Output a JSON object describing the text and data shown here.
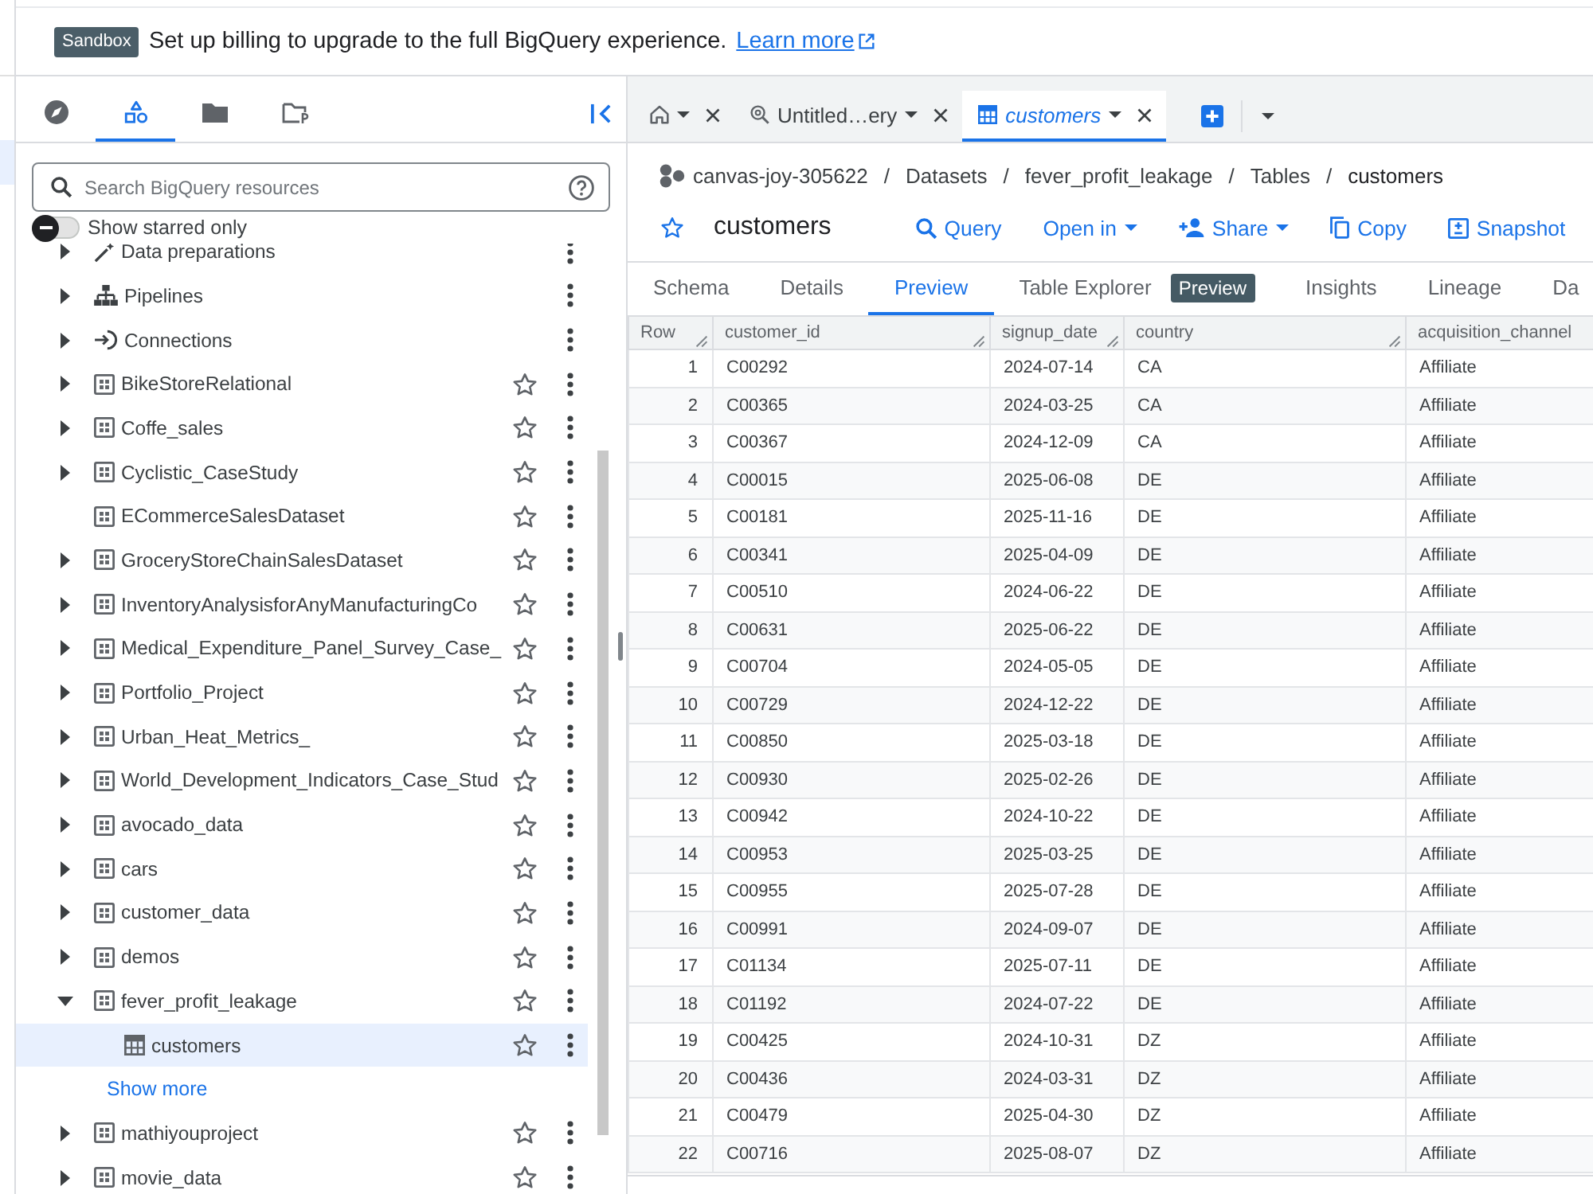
{
  "banner": {
    "badge": "Sandbox",
    "message": "Set up billing to upgrade to the full BigQuery experience.",
    "link": "Learn more"
  },
  "explorer": {
    "icon_tabs": [
      {
        "kind": "explore",
        "selected": false
      },
      {
        "kind": "resources",
        "selected": true
      },
      {
        "kind": "files",
        "selected": false
      },
      {
        "kind": "repositories",
        "selected": false
      }
    ],
    "search": {
      "placeholder": "Search BigQuery resources"
    },
    "starred_filter": {
      "label": "Show starred only",
      "on": false
    },
    "tree": [
      {
        "kind": "data_preparations",
        "label": "Data preparations",
        "expandable": true,
        "expanded": false,
        "selected": false
      },
      {
        "kind": "pipelines",
        "label": "Pipelines",
        "expandable": true,
        "expanded": false,
        "selected": false
      },
      {
        "kind": "connections",
        "label": "Connections",
        "expandable": true,
        "expanded": false,
        "selected": false
      },
      {
        "kind": "dataset",
        "label": "BikeStoreRelational",
        "expandable": true,
        "expanded": false,
        "selected": false,
        "starred": false
      },
      {
        "kind": "dataset",
        "label": "Coffe_sales",
        "expandable": true,
        "expanded": false,
        "selected": false,
        "starred": false
      },
      {
        "kind": "dataset",
        "label": "Cyclistic_CaseStudy",
        "expandable": true,
        "expanded": false,
        "selected": false,
        "starred": false
      },
      {
        "kind": "dataset",
        "label": "ECommerceSalesDataset",
        "expandable": false,
        "selected": false,
        "starred": false
      },
      {
        "kind": "dataset",
        "label": "GroceryStoreChainSalesDataset",
        "expandable": true,
        "expanded": false,
        "selected": false,
        "starred": false
      },
      {
        "kind": "dataset",
        "label": "InventoryAnalysisforAnyManufacturingCo",
        "expandable": true,
        "expanded": false,
        "selected": false,
        "starred": false
      },
      {
        "kind": "dataset",
        "label": "Medical_Expenditure_Panel_Survey_Case_",
        "expandable": true,
        "expanded": false,
        "selected": false,
        "starred": false
      },
      {
        "kind": "dataset",
        "label": "Portfolio_Project",
        "expandable": true,
        "expanded": false,
        "selected": false,
        "starred": false
      },
      {
        "kind": "dataset",
        "label": "Urban_Heat_Metrics_",
        "expandable": true,
        "expanded": false,
        "selected": false,
        "starred": false
      },
      {
        "kind": "dataset",
        "label": "World_Development_Indicators_Case_Stud",
        "expandable": true,
        "expanded": false,
        "selected": false,
        "starred": false
      },
      {
        "kind": "dataset",
        "label": "avocado_data",
        "expandable": true,
        "expanded": false,
        "selected": false,
        "starred": false
      },
      {
        "kind": "dataset",
        "label": "cars",
        "expandable": true,
        "expanded": false,
        "selected": false,
        "starred": false
      },
      {
        "kind": "dataset",
        "label": "customer_data",
        "expandable": true,
        "expanded": false,
        "selected": false,
        "starred": false
      },
      {
        "kind": "dataset",
        "label": "demos",
        "expandable": true,
        "expanded": false,
        "selected": false,
        "starred": false
      },
      {
        "kind": "dataset",
        "label": "fever_profit_leakage",
        "expandable": true,
        "expanded": true,
        "selected": false,
        "starred": false,
        "children": [
          {
            "kind": "table",
            "label": "customers",
            "expandable": false,
            "selected": true,
            "starred": false
          }
        ],
        "show_more": "Show more"
      },
      {
        "kind": "dataset",
        "label": "mathiyouproject",
        "expandable": true,
        "expanded": false,
        "selected": false,
        "starred": false
      },
      {
        "kind": "dataset",
        "label": "movie_data",
        "expandable": true,
        "expanded": false,
        "selected": false,
        "starred": false
      }
    ]
  },
  "editor_tabs": [
    {
      "kind": "home",
      "selected": false
    },
    {
      "kind": "query",
      "label": "Untitled…ery",
      "selected": false,
      "temporary": false
    },
    {
      "kind": "table",
      "label": "customers",
      "selected": true,
      "temporary": true
    }
  ],
  "breadcrumb": {
    "separator": "/",
    "items": [
      {
        "label": "canvas-joy-305622",
        "current": false
      },
      {
        "label": "Datasets",
        "current": false
      },
      {
        "label": "fever_profit_leakage",
        "current": false
      },
      {
        "label": "Tables",
        "current": false
      },
      {
        "label": "customers",
        "current": true
      }
    ]
  },
  "header": {
    "starred": false,
    "title": "customers",
    "actions": [
      {
        "kind": "query",
        "label": "Query",
        "menu": false
      },
      {
        "kind": "open",
        "label": "Open in",
        "menu": true
      },
      {
        "kind": "share",
        "label": "Share",
        "menu": true
      },
      {
        "kind": "copy",
        "label": "Copy",
        "menu": false
      },
      {
        "kind": "snapshot",
        "label": "Snapshot",
        "menu": false
      }
    ]
  },
  "detail_tabs": [
    {
      "label": "Schema",
      "selected": false
    },
    {
      "label": "Details",
      "selected": false
    },
    {
      "label": "Preview",
      "selected": true
    },
    {
      "label": "Table Explorer",
      "badge": "Preview",
      "selected": false
    },
    {
      "label": "Insights",
      "selected": false
    },
    {
      "label": "Lineage",
      "selected": false
    },
    {
      "label": "Da",
      "selected": false
    }
  ],
  "table": {
    "columns": [
      "Row",
      "customer_id",
      "signup_date",
      "country",
      "acquisition_channel"
    ],
    "rows": [
      [
        "1",
        "C00292",
        "2024-07-14",
        "CA",
        "Affiliate"
      ],
      [
        "2",
        "C00365",
        "2024-03-25",
        "CA",
        "Affiliate"
      ],
      [
        "3",
        "C00367",
        "2024-12-09",
        "CA",
        "Affiliate"
      ],
      [
        "4",
        "C00015",
        "2025-06-08",
        "DE",
        "Affiliate"
      ],
      [
        "5",
        "C00181",
        "2025-11-16",
        "DE",
        "Affiliate"
      ],
      [
        "6",
        "C00341",
        "2025-04-09",
        "DE",
        "Affiliate"
      ],
      [
        "7",
        "C00510",
        "2024-06-22",
        "DE",
        "Affiliate"
      ],
      [
        "8",
        "C00631",
        "2025-06-22",
        "DE",
        "Affiliate"
      ],
      [
        "9",
        "C00704",
        "2024-05-05",
        "DE",
        "Affiliate"
      ],
      [
        "10",
        "C00729",
        "2024-12-22",
        "DE",
        "Affiliate"
      ],
      [
        "11",
        "C00850",
        "2025-03-18",
        "DE",
        "Affiliate"
      ],
      [
        "12",
        "C00930",
        "2025-02-26",
        "DE",
        "Affiliate"
      ],
      [
        "13",
        "C00942",
        "2024-10-22",
        "DE",
        "Affiliate"
      ],
      [
        "14",
        "C00953",
        "2025-03-25",
        "DE",
        "Affiliate"
      ],
      [
        "15",
        "C00955",
        "2025-07-28",
        "DE",
        "Affiliate"
      ],
      [
        "16",
        "C00991",
        "2024-09-07",
        "DE",
        "Affiliate"
      ],
      [
        "17",
        "C01134",
        "2025-07-11",
        "DE",
        "Affiliate"
      ],
      [
        "18",
        "C01192",
        "2024-07-22",
        "DE",
        "Affiliate"
      ],
      [
        "19",
        "C00425",
        "2024-10-31",
        "DZ",
        "Affiliate"
      ],
      [
        "20",
        "C00436",
        "2024-03-31",
        "DZ",
        "Affiliate"
      ],
      [
        "21",
        "C00479",
        "2025-04-30",
        "DZ",
        "Affiliate"
      ],
      [
        "22",
        "C00716",
        "2025-08-07",
        "DZ",
        "Affiliate"
      ]
    ]
  }
}
